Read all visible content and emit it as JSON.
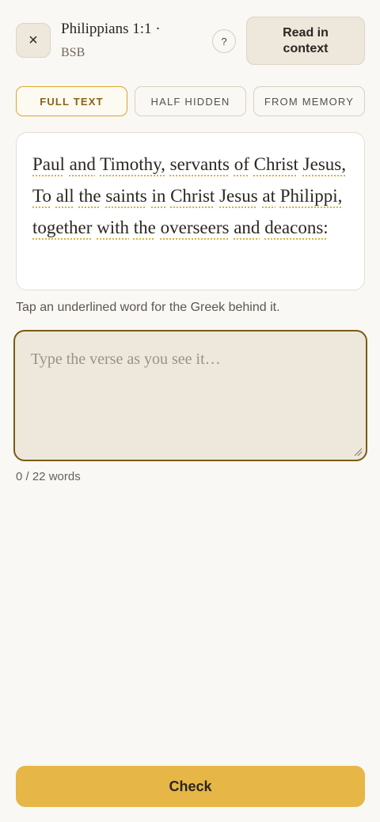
{
  "header": {
    "close_icon": "×",
    "reference": "Philippians 1:1 ·",
    "version": "BSB",
    "help_label": "?",
    "context_button": "Read in context"
  },
  "modes": [
    {
      "label": "FULL TEXT",
      "active": true
    },
    {
      "label": "HALF HIDDEN",
      "active": false
    },
    {
      "label": "FROM MEMORY",
      "active": false
    }
  ],
  "verse": {
    "words": [
      "Paul",
      "and",
      "Timothy,",
      "servants",
      "of",
      "Christ",
      "Jesus,",
      "To",
      "all",
      "the",
      "saints",
      "in",
      "Christ",
      "Jesus",
      "at",
      "Philippi,",
      "together",
      "with",
      "the",
      "overseers",
      "and",
      "deacons:"
    ]
  },
  "hint": "Tap an underlined word for the Greek behind it.",
  "input": {
    "placeholder": "Type the verse as you see it…",
    "value": ""
  },
  "word_count": "0 / 22 words",
  "check_button": "Check",
  "colors": {
    "background": "#faf8f4",
    "accent": "#e6b647",
    "active_mode": "#d9a72c",
    "input_border": "#7a5a14"
  }
}
